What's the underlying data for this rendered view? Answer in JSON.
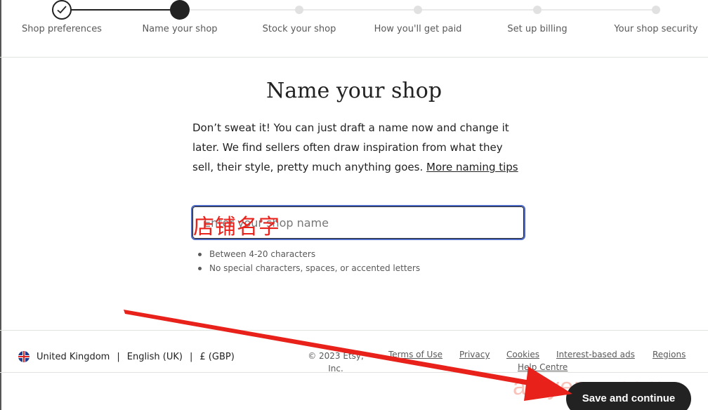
{
  "stepper": {
    "steps": [
      {
        "label": "Shop preferences",
        "state": "done"
      },
      {
        "label": "Name your shop",
        "state": "current"
      },
      {
        "label": "Stock your shop",
        "state": "todo"
      },
      {
        "label": "How you'll get paid",
        "state": "todo"
      },
      {
        "label": "Set up billing",
        "state": "todo"
      },
      {
        "label": "Your shop security",
        "state": "todo"
      }
    ]
  },
  "main": {
    "title": "Name your shop",
    "intro": "Don’t sweat it! You can just draft a name now and change it later. We find sellers often draw inspiration from what they sell, their style, pretty much anything goes.",
    "tips_link": "More naming tips",
    "shop_name_input": {
      "value": "",
      "placeholder": "Enter your shop name"
    },
    "annotation_overlay": "店铺名字",
    "rules": [
      "Between 4-20 characters",
      "No special characters, spaces, or accented letters"
    ]
  },
  "footer": {
    "country": "United Kingdom",
    "language": "English (UK)",
    "currency": "£ (GBP)",
    "copyright_line1": "© 2023 Etsy,",
    "copyright_line2": "Inc.",
    "links": {
      "terms": "Terms of Use",
      "privacy": "Privacy",
      "cookies": "Cookies",
      "interest_ads": "Interest-based ads",
      "regions": "Regions",
      "help": "Help Centre"
    }
  },
  "actions": {
    "save_label": "Save and continue"
  },
  "watermark": "amyeruu.com",
  "colors": {
    "accent_focus": "#4d6bc6",
    "annotation_red": "#e8211b",
    "primary_button": "#222222"
  }
}
